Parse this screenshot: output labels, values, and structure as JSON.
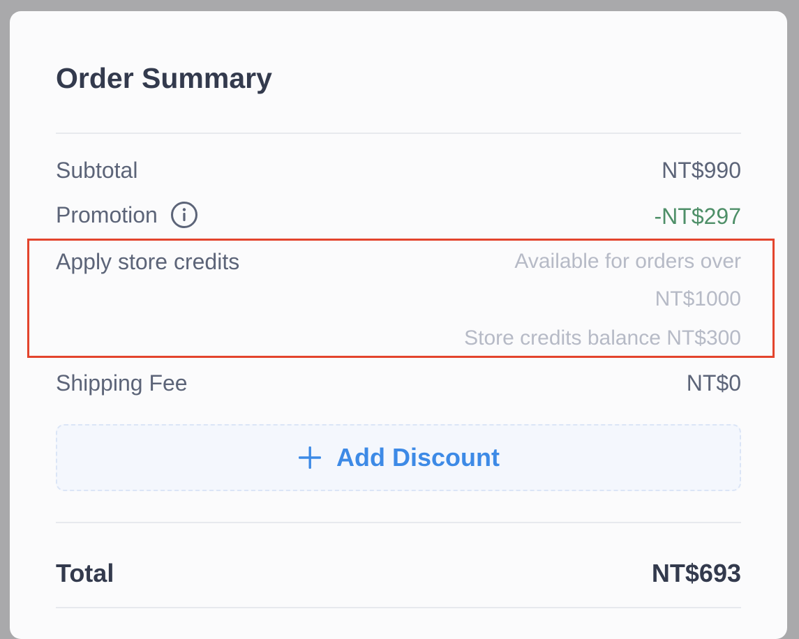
{
  "order_summary": {
    "title": "Order Summary",
    "rows": {
      "subtotal": {
        "label": "Subtotal",
        "value": "NT$990"
      },
      "promotion": {
        "label": "Promotion",
        "value": "-NT$297",
        "value_color": "#4e8f68",
        "icon": "info-icon"
      },
      "store_credits": {
        "label": "Apply store credits",
        "note_line1": "Available for orders over",
        "note_line2": "NT$1000",
        "note_line3": "Store credits balance NT$300"
      },
      "shipping": {
        "label": "Shipping Fee",
        "value": "NT$0"
      }
    },
    "add_discount": {
      "label": "Add Discount",
      "icon": "plus-icon",
      "color": "#3d8ae6"
    },
    "total": {
      "label": "Total",
      "value": "NT$693"
    }
  },
  "colors": {
    "highlight_border": "#e3442d",
    "text_primary": "#333a4d",
    "text_secondary": "#5c6478",
    "text_muted": "#b6bac6",
    "accent": "#3d8ae6",
    "positive": "#4e8f68"
  }
}
